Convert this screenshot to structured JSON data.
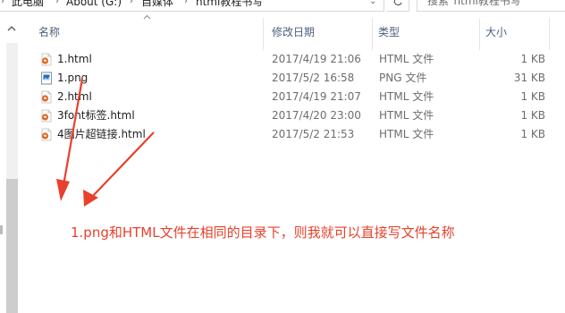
{
  "address_bar": {
    "crumbs": [
      "此电脑",
      "About (G:)",
      "自媒体",
      "html教程书写"
    ],
    "search_placeholder": "搜索\"html教程书写\""
  },
  "columns": {
    "name": "名称",
    "date": "修改日期",
    "type": "类型",
    "size": "大小"
  },
  "files": [
    {
      "name": "1.html",
      "date": "2017/4/19 21:06",
      "type": "HTML 文件",
      "size": "1 KB",
      "icon": "html-file-icon"
    },
    {
      "name": "1.png",
      "date": "2017/5/2 16:58",
      "type": "PNG 文件",
      "size": "31 KB",
      "icon": "png-file-icon"
    },
    {
      "name": "2.html",
      "date": "2017/4/19 21:07",
      "type": "HTML 文件",
      "size": "1 KB",
      "icon": "html-file-icon"
    },
    {
      "name": "3font标签.html",
      "date": "2017/4/20 23:00",
      "type": "HTML 文件",
      "size": "1 KB",
      "icon": "html-file-icon"
    },
    {
      "name": "4图片超链接.html",
      "date": "2017/5/2 21:53",
      "type": "HTML 文件",
      "size": "1 KB",
      "icon": "html-file-icon"
    }
  ],
  "annotation": {
    "text": "1.png和HTML文件在相同的目录下，则我就可以直接写文件名称",
    "color": "#e8412c"
  },
  "colors": {
    "header_text": "#4c607a",
    "html_icon": "#e4641f",
    "png_icon": "#2a6bb5"
  }
}
